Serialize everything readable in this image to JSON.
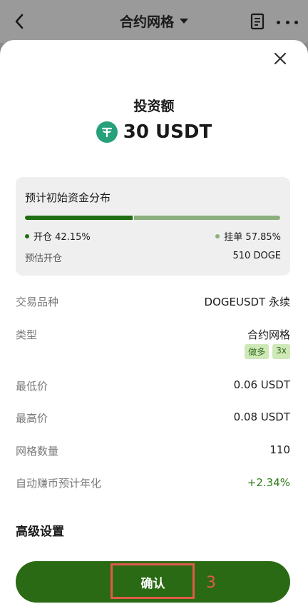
{
  "header": {
    "title": "合约网格"
  },
  "modal": {
    "invest_label": "投资额",
    "invest_amount": "30 USDT",
    "distribution": {
      "title": "预计初始资金分布",
      "open_label": "开仓 42.15%",
      "open_fraction": 0.4215,
      "pending_label": "挂单 57.85%",
      "est_open_label": "预估开仓",
      "est_open_value": "510 DOGE"
    },
    "rows": [
      {
        "label": "交易品种",
        "value": "DOGEUSDT 永续"
      },
      {
        "label": "类型",
        "value": "合约网格"
      },
      {
        "label": "最低价",
        "value": "0.06 USDT"
      },
      {
        "label": "最高价",
        "value": "0.08 USDT"
      },
      {
        "label": "网格数量",
        "value": "110"
      },
      {
        "label": "自动赚币预计年化",
        "value": "+2.34%"
      }
    ],
    "tags": [
      "做多",
      "3x"
    ],
    "advanced_label": "高级设置",
    "confirm_label": "确认",
    "annotation_number": "3"
  },
  "colors": {
    "primary": "#2a6a14",
    "open_bar": "#1f6e12",
    "pending_bar": "#8bb07e",
    "positive": "#2e7d1a",
    "highlight": "#e05a4a"
  }
}
